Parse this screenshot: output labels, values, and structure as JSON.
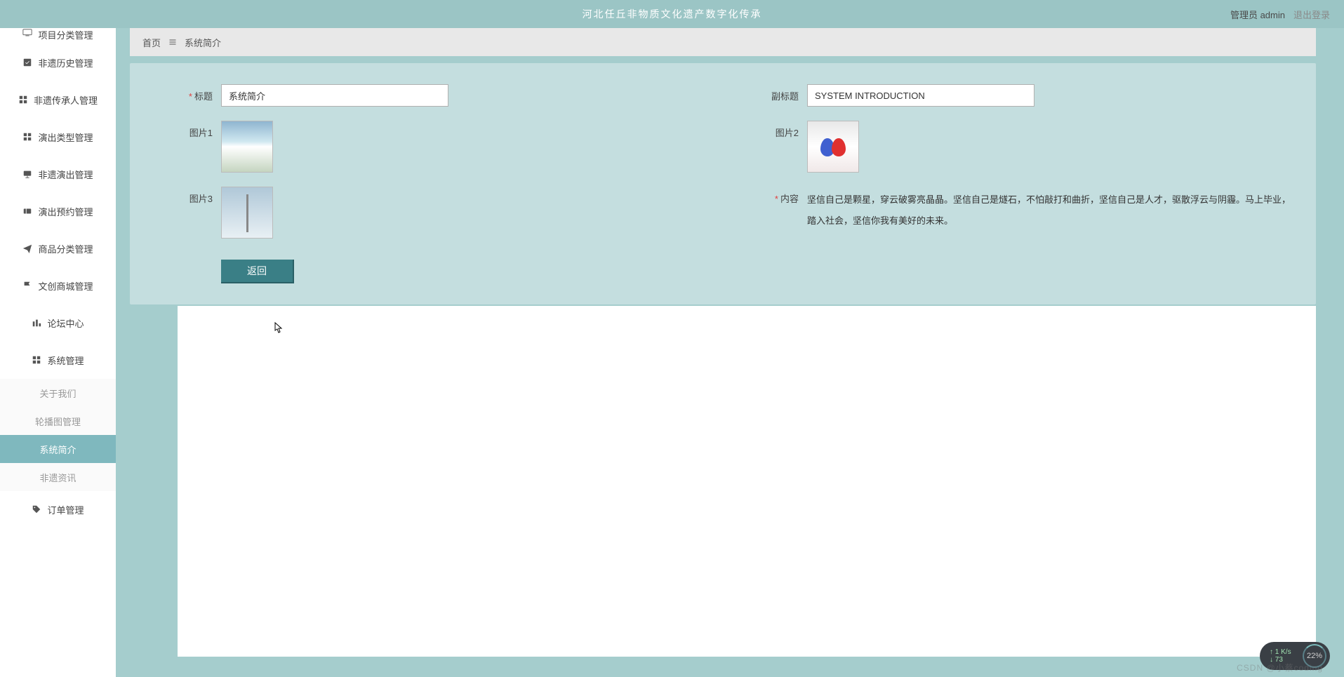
{
  "header": {
    "title": "河北任丘非物质文化遗产数字化传承",
    "user_label": "管理员 admin",
    "logout_label": "退出登录"
  },
  "sidebar": {
    "items": [
      {
        "label": "项目分类管理",
        "icon": "monitor"
      },
      {
        "label": "非遗历史管理",
        "icon": "check-square"
      },
      {
        "label": "非遗传承人管理",
        "icon": "grid"
      },
      {
        "label": "演出类型管理",
        "icon": "grid"
      },
      {
        "label": "非遗演出管理",
        "icon": "presentation"
      },
      {
        "label": "演出预约管理",
        "icon": "ticket"
      },
      {
        "label": "商品分类管理",
        "icon": "send"
      },
      {
        "label": "文创商城管理",
        "icon": "flag"
      },
      {
        "label": "论坛中心",
        "icon": "bars"
      },
      {
        "label": "系统管理",
        "icon": "grid"
      },
      {
        "label": "订单管理",
        "icon": "tag"
      }
    ],
    "subs": [
      {
        "label": "关于我们"
      },
      {
        "label": "轮播图管理"
      },
      {
        "label": "系统简介",
        "active": true
      },
      {
        "label": "非遗资讯"
      }
    ]
  },
  "breadcrumb": {
    "home": "首页",
    "current": "系统简介"
  },
  "form": {
    "title_label": "标题",
    "title_value": "系统简介",
    "subtitle_label": "副标题",
    "subtitle_value": "SYSTEM INTRODUCTION",
    "img1_label": "图片1",
    "img2_label": "图片2",
    "img3_label": "图片3",
    "content_label": "内容",
    "content_value": "坚信自己是颗星，穿云破雾亮晶晶。坚信自己是燧石，不怕敲打和曲折，坚信自己是人才，驱散浮云与阴霾。马上毕业，踏入社会，坚信你我有美好的未来。",
    "back_button": "返回"
  },
  "widget": {
    "speed_up": "1 K/s",
    "speed_down": "73",
    "percent": "22%"
  },
  "watermark": "CSDN @小蔡coding"
}
